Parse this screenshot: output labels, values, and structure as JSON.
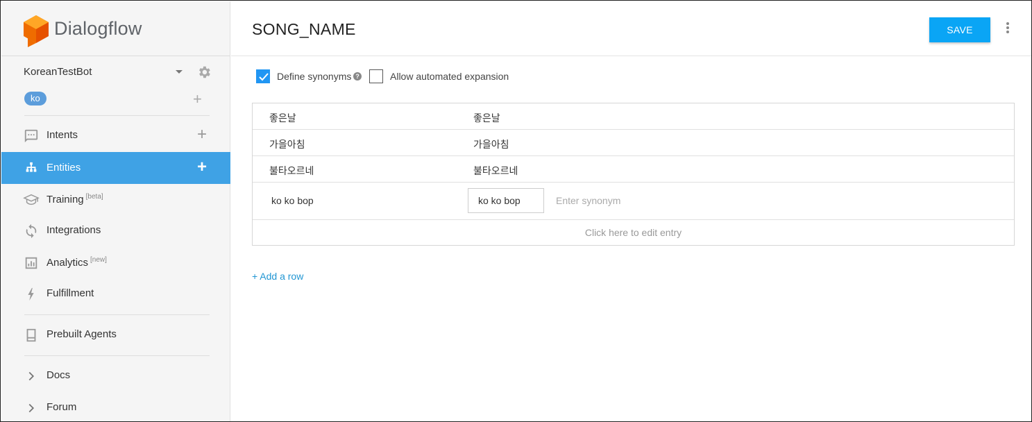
{
  "app": {
    "brand": "Dialogflow",
    "accent": "#3fa2e5",
    "logo_color": "#f57c00"
  },
  "sidebar": {
    "agent_name": "KoreanTestBot",
    "language": "ko",
    "nav": [
      {
        "label": "Intents",
        "icon": "chat-icon",
        "sup": ""
      },
      {
        "label": "Entities",
        "icon": "hierarchy-icon",
        "sup": ""
      },
      {
        "label": "Training",
        "icon": "graduation-cap-icon",
        "sup": "[beta]"
      },
      {
        "label": "Integrations",
        "icon": "sync-icon",
        "sup": ""
      },
      {
        "label": "Analytics",
        "icon": "bar-chart-icon",
        "sup": "[new]"
      },
      {
        "label": "Fulfillment",
        "icon": "lightning-icon",
        "sup": ""
      },
      {
        "label": "Prebuilt Agents",
        "icon": "book-icon",
        "sup": ""
      },
      {
        "label": "Docs",
        "icon": "chevron-right-icon",
        "sup": ""
      },
      {
        "label": "Forum",
        "icon": "chevron-right-icon",
        "sup": ""
      }
    ]
  },
  "header": {
    "title": "SONG_NAME",
    "save_label": "SAVE"
  },
  "options": {
    "define_synonyms": {
      "label": "Define synonyms",
      "checked": true
    },
    "automated_expansion": {
      "label": "Allow automated expansion",
      "checked": false
    }
  },
  "entries": [
    {
      "reference": "좋은날",
      "synonyms": "좋은날"
    },
    {
      "reference": "가을아침",
      "synonyms": "가을아침"
    },
    {
      "reference": "불타오르네",
      "synonyms": "불타오르네"
    }
  ],
  "editing_entry": {
    "reference": "ko ko bop",
    "synonym_chip": "ko ko bop",
    "placeholder": "Enter synonym"
  },
  "footer_row": "Click here to edit entry",
  "add_row": "+ Add a row"
}
